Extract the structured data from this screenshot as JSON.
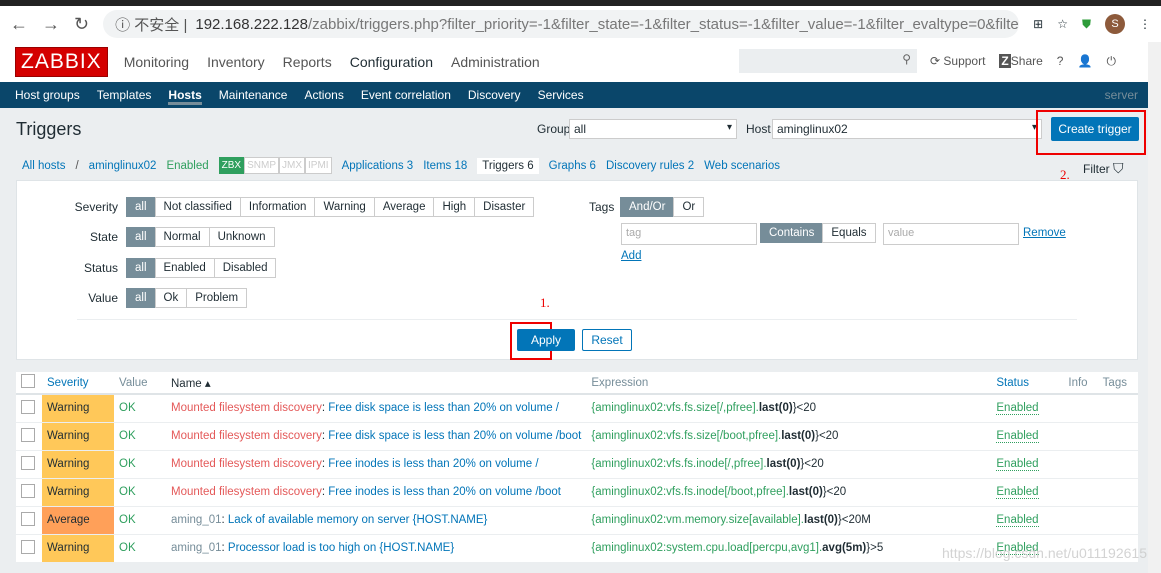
{
  "browser": {
    "security": "不安全",
    "url_host": "192.168.222.128",
    "url_path": "/zabbix/triggers.php?filter_priority=-1&filter_state=-1&filter_status=-1&filter_value=-1&filter_evaltype=0&filter_t...",
    "avatar": "S"
  },
  "header": {
    "logo": "ZABBIX",
    "menu": [
      "Monitoring",
      "Inventory",
      "Reports",
      "Configuration",
      "Administration"
    ],
    "support": "Support",
    "share": "Share",
    "help": "?"
  },
  "subnav": {
    "items": [
      "Host groups",
      "Templates",
      "Hosts",
      "Maintenance",
      "Actions",
      "Event correlation",
      "Discovery",
      "Services"
    ],
    "server": "server"
  },
  "page": {
    "title": "Triggers",
    "group_label": "Group",
    "group_value": "all",
    "host_label": "Host",
    "host_value": "aminglinux02",
    "create": "Create trigger",
    "filter": "Filter"
  },
  "hostnav": {
    "all_hosts": "All hosts",
    "host": "aminglinux02",
    "status": "Enabled",
    "tags": [
      "ZBX",
      "SNMP",
      "JMX",
      "IPMI"
    ],
    "links": [
      "Applications 3",
      "Items 18",
      "Triggers 6",
      "Graphs 6",
      "Discovery rules 2",
      "Web scenarios"
    ]
  },
  "annotations": {
    "one": "1.",
    "two": "2."
  },
  "filter": {
    "severity": {
      "label": "Severity",
      "options": [
        "all",
        "Not classified",
        "Information",
        "Warning",
        "Average",
        "High",
        "Disaster"
      ]
    },
    "state": {
      "label": "State",
      "options": [
        "all",
        "Normal",
        "Unknown"
      ]
    },
    "status": {
      "label": "Status",
      "options": [
        "all",
        "Enabled",
        "Disabled"
      ]
    },
    "value": {
      "label": "Value",
      "options": [
        "all",
        "Ok",
        "Problem"
      ]
    },
    "tags": {
      "label": "Tags",
      "options": [
        "And/Or",
        "Or"
      ],
      "tag_placeholder": "tag",
      "ops": [
        "Contains",
        "Equals"
      ],
      "value_placeholder": "value",
      "remove": "Remove",
      "add": "Add"
    },
    "apply": "Apply",
    "reset": "Reset"
  },
  "table": {
    "headers": [
      "Severity",
      "Value",
      "Name ▴",
      "Expression",
      "Status",
      "Info",
      "Tags"
    ],
    "rows": [
      {
        "severity": "Warning",
        "value": "OK",
        "prefix": "Mounted filesystem discovery",
        "name": "Free disk space is less than 20% on volume /",
        "expr": "{aminglinux02:vfs.fs.size[/,pfree].",
        "fn": "last(0)",
        "tail": "}<20",
        "status": "Enabled"
      },
      {
        "severity": "Warning",
        "value": "OK",
        "prefix": "Mounted filesystem discovery",
        "name": "Free disk space is less than 20% on volume /boot",
        "expr": "{aminglinux02:vfs.fs.size[/boot,pfree].",
        "fn": "last(0)",
        "tail": "}<20",
        "status": "Enabled"
      },
      {
        "severity": "Warning",
        "value": "OK",
        "prefix": "Mounted filesystem discovery",
        "name": "Free inodes is less than 20% on volume /",
        "expr": "{aminglinux02:vfs.fs.inode[/,pfree].",
        "fn": "last(0)",
        "tail": "}<20",
        "status": "Enabled"
      },
      {
        "severity": "Warning",
        "value": "OK",
        "prefix": "Mounted filesystem discovery",
        "name": "Free inodes is less than 20% on volume /boot",
        "expr": "{aminglinux02:vfs.fs.inode[/boot,pfree].",
        "fn": "last(0)",
        "tail": "}<20",
        "status": "Enabled"
      },
      {
        "severity": "Average",
        "value": "OK",
        "prefix": "aming_01",
        "name": "Lack of available memory on server {HOST.NAME}",
        "expr": "{aminglinux02:vm.memory.size[available].",
        "fn": "last(0)",
        "tail": "}<20M",
        "status": "Enabled"
      },
      {
        "severity": "Warning",
        "value": "OK",
        "prefix": "aming_01",
        "name": "Processor load is too high on {HOST.NAME}",
        "expr": "{aminglinux02:system.cpu.load[percpu,avg1].",
        "fn": "avg(5m)",
        "tail": "}>5",
        "status": "Enabled"
      }
    ]
  },
  "watermark": "https://blog.csdn.net/u011192615"
}
